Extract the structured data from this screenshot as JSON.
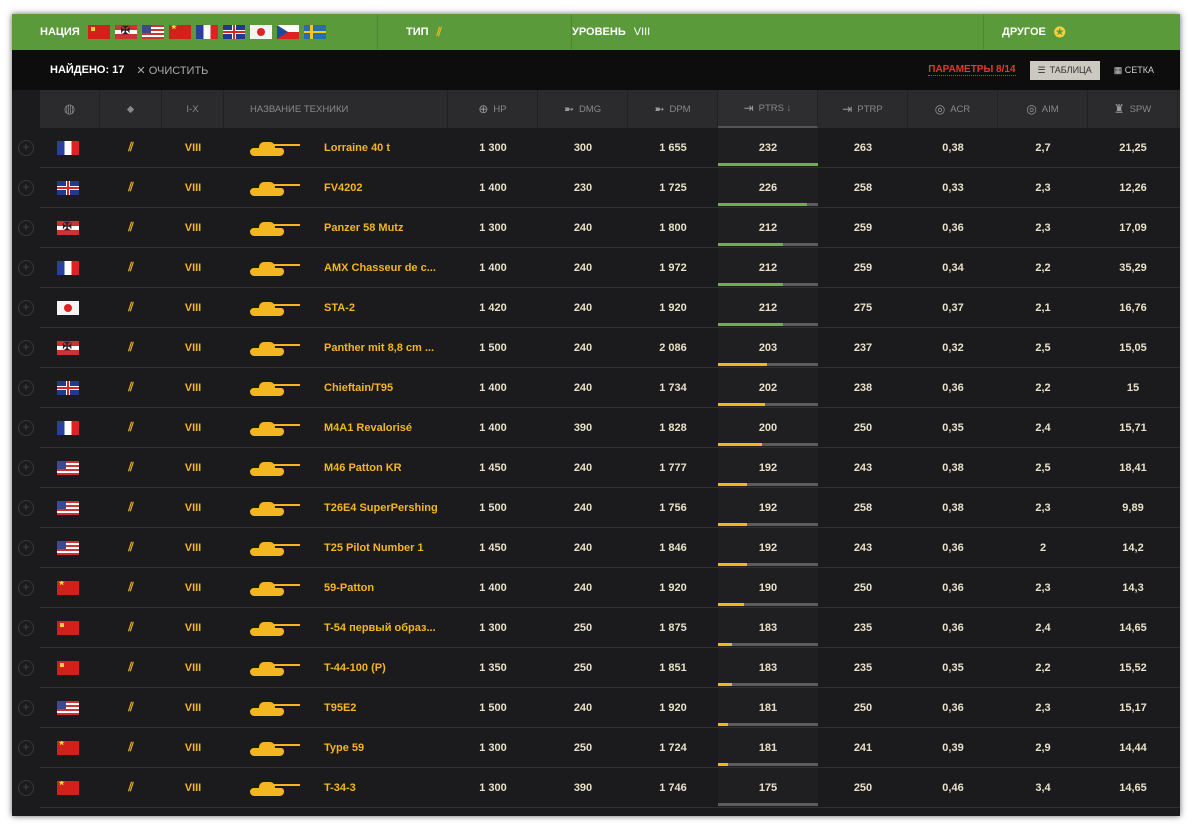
{
  "filters": {
    "nation_label": "НАЦИЯ",
    "nations": [
      "ussr",
      "de",
      "us",
      "cn",
      "fr",
      "uk",
      "jp",
      "cz",
      "se"
    ],
    "type_label": "ТИП",
    "level_label": "УРОВЕНЬ",
    "level_value": "VIII",
    "other_label": "ДРУГОЕ"
  },
  "toolbar": {
    "found": "НАЙДЕНО: 17",
    "clear": "ОЧИСТИТЬ",
    "params": "ПАРАМЕТРЫ 8/14",
    "table": "ТАБЛИЦА",
    "grid": "СЕТКА"
  },
  "columns": {
    "tier": "I-X",
    "name": "НАЗВАНИЕ ТЕХНИКИ",
    "hp": "HP",
    "dmg": "DMG",
    "dpm": "DPM",
    "ptrs": "PTRS ↓",
    "ptrp": "PTRP",
    "acr": "ACR",
    "aim": "AIM",
    "spw": "SPW"
  },
  "colors": {
    "green": "#6ab04c",
    "yellow": "#f3b521",
    "accent": "#5a9a3a",
    "red": "#e23a2a"
  },
  "rows": [
    {
      "nation": "fr",
      "tier": "VIII",
      "name": "Lorraine 40 t",
      "hp": "1 300",
      "dmg": "300",
      "dpm": "1 655",
      "ptrs": "232",
      "ptrp": "263",
      "acr": "0,38",
      "aim": "2,7",
      "spw": "21,25",
      "bar": 100
    },
    {
      "nation": "uk",
      "tier": "VIII",
      "name": "FV4202",
      "hp": "1 400",
      "dmg": "230",
      "dpm": "1 725",
      "ptrs": "226",
      "ptrp": "258",
      "acr": "0,33",
      "aim": "2,3",
      "spw": "12,26",
      "bar": 89
    },
    {
      "nation": "de",
      "tier": "VIII",
      "name": "Panzer 58 Mutz",
      "hp": "1 300",
      "dmg": "240",
      "dpm": "1 800",
      "ptrs": "212",
      "ptrp": "259",
      "acr": "0,36",
      "aim": "2,3",
      "spw": "17,09",
      "bar": 65
    },
    {
      "nation": "fr",
      "tier": "VIII",
      "name": "AMX Chasseur de c...",
      "hp": "1 400",
      "dmg": "240",
      "dpm": "1 972",
      "ptrs": "212",
      "ptrp": "259",
      "acr": "0,34",
      "aim": "2,2",
      "spw": "35,29",
      "bar": 65
    },
    {
      "nation": "jp",
      "tier": "VIII",
      "name": "STA-2",
      "hp": "1 420",
      "dmg": "240",
      "dpm": "1 920",
      "ptrs": "212",
      "ptrp": "275",
      "acr": "0,37",
      "aim": "2,1",
      "spw": "16,76",
      "bar": 65
    },
    {
      "nation": "de",
      "tier": "VIII",
      "name": "Panther mit 8,8 cm ...",
      "hp": "1 500",
      "dmg": "240",
      "dpm": "2 086",
      "ptrs": "203",
      "ptrp": "237",
      "acr": "0,32",
      "aim": "2,5",
      "spw": "15,05",
      "bar": 49
    },
    {
      "nation": "uk",
      "tier": "VIII",
      "name": "Chieftain/T95",
      "hp": "1 400",
      "dmg": "240",
      "dpm": "1 734",
      "ptrs": "202",
      "ptrp": "238",
      "acr": "0,36",
      "aim": "2,2",
      "spw": "15",
      "bar": 47
    },
    {
      "nation": "fr",
      "tier": "VIII",
      "name": "M4A1 Revalorisé",
      "hp": "1 400",
      "dmg": "390",
      "dpm": "1 828",
      "ptrs": "200",
      "ptrp": "250",
      "acr": "0,35",
      "aim": "2,4",
      "spw": "15,71",
      "bar": 44
    },
    {
      "nation": "us",
      "tier": "VIII",
      "name": "M46 Patton KR",
      "hp": "1 450",
      "dmg": "240",
      "dpm": "1 777",
      "ptrs": "192",
      "ptrp": "243",
      "acr": "0,38",
      "aim": "2,5",
      "spw": "18,41",
      "bar": 29
    },
    {
      "nation": "us",
      "tier": "VIII",
      "name": "T26E4 SuperPershing",
      "hp": "1 500",
      "dmg": "240",
      "dpm": "1 756",
      "ptrs": "192",
      "ptrp": "258",
      "acr": "0,38",
      "aim": "2,3",
      "spw": "9,89",
      "bar": 29
    },
    {
      "nation": "us",
      "tier": "VIII",
      "name": "T25 Pilot Number 1",
      "hp": "1 450",
      "dmg": "240",
      "dpm": "1 846",
      "ptrs": "192",
      "ptrp": "243",
      "acr": "0,36",
      "aim": "2",
      "spw": "14,2",
      "bar": 29
    },
    {
      "nation": "cn",
      "tier": "VIII",
      "name": "59-Patton",
      "hp": "1 400",
      "dmg": "240",
      "dpm": "1 920",
      "ptrs": "190",
      "ptrp": "250",
      "acr": "0,36",
      "aim": "2,3",
      "spw": "14,3",
      "bar": 26
    },
    {
      "nation": "ussr",
      "tier": "VIII",
      "name": "T-54 первый образ...",
      "hp": "1 300",
      "dmg": "250",
      "dpm": "1 875",
      "ptrs": "183",
      "ptrp": "235",
      "acr": "0,36",
      "aim": "2,4",
      "spw": "14,65",
      "bar": 14
    },
    {
      "nation": "ussr",
      "tier": "VIII",
      "name": "T-44-100 (P)",
      "hp": "1 350",
      "dmg": "250",
      "dpm": "1 851",
      "ptrs": "183",
      "ptrp": "235",
      "acr": "0,35",
      "aim": "2,2",
      "spw": "15,52",
      "bar": 14
    },
    {
      "nation": "us",
      "tier": "VIII",
      "name": "T95E2",
      "hp": "1 500",
      "dmg": "240",
      "dpm": "1 920",
      "ptrs": "181",
      "ptrp": "250",
      "acr": "0,36",
      "aim": "2,3",
      "spw": "15,17",
      "bar": 10
    },
    {
      "nation": "cn",
      "tier": "VIII",
      "name": "Type 59",
      "hp": "1 300",
      "dmg": "250",
      "dpm": "1 724",
      "ptrs": "181",
      "ptrp": "241",
      "acr": "0,39",
      "aim": "2,9",
      "spw": "14,44",
      "bar": 10
    },
    {
      "nation": "cn",
      "tier": "VIII",
      "name": "T-34-3",
      "hp": "1 300",
      "dmg": "390",
      "dpm": "1 746",
      "ptrs": "175",
      "ptrp": "250",
      "acr": "0,46",
      "aim": "3,4",
      "spw": "14,65",
      "bar": 0
    }
  ]
}
